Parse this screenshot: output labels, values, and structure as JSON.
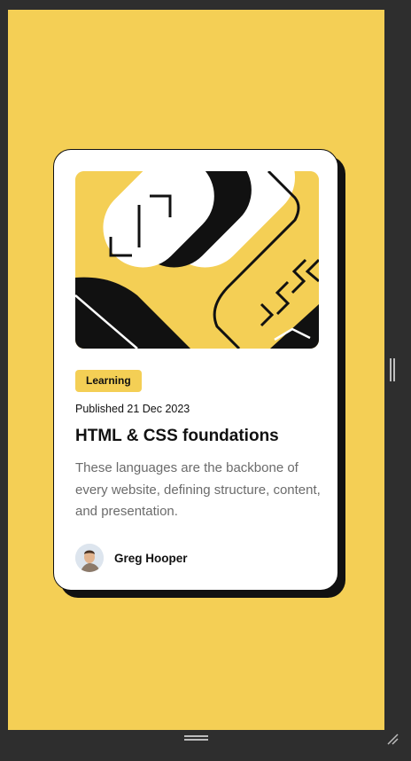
{
  "card": {
    "tag": "Learning",
    "published": "Published 21 Dec 2023",
    "title": "HTML & CSS foundations",
    "description": "These languages are the backbone of every website, defining structure, content, and presentation.",
    "author": {
      "name": "Greg Hooper"
    }
  },
  "colors": {
    "background": "#f4cf55",
    "card": "#ffffff",
    "text": "#111111",
    "muted": "#6b6b6b"
  },
  "icons": {
    "resize_side": "vertical-grip-icon",
    "resize_bottom": "horizontal-grip-icon",
    "resize_corner": "corner-resize-icon"
  }
}
